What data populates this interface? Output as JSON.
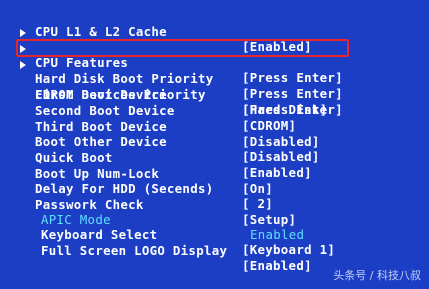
{
  "rows": [
    {
      "label": "CPU L1 & L2 Cache",
      "value": "[Enabled]",
      "arrow": false
    },
    {
      "label": "CPU Features",
      "value": "[Press Enter]",
      "arrow": true
    },
    {
      "label": "Hard Disk Boot Priority",
      "value": "[Press Enter]",
      "arrow": true
    },
    {
      "label": "CDROM Devices Priority",
      "value": "[Press Enter]",
      "arrow": true
    },
    {
      "label": "First Boot Device",
      "value": "[Hard Disk]",
      "arrow": false
    },
    {
      "label": "Second Boot Device",
      "value": "[CDROM]",
      "arrow": false
    },
    {
      "label": "Third Boot Device",
      "value": "[Disabled]",
      "arrow": false
    },
    {
      "label": "Boot Other Device",
      "value": "[Disabled]",
      "arrow": false
    },
    {
      "label": "Quick Boot",
      "value": "[Enabled]",
      "arrow": false
    },
    {
      "label": "Boot Up Num-Lock",
      "value": "[On]",
      "arrow": false
    },
    {
      "label": "Delay For HDD (Secends)",
      "value": "[ 2]",
      "arrow": false
    },
    {
      "label": "Passwork Check",
      "value": "[Setup]",
      "arrow": false
    },
    {
      "label": "APIC Mode",
      "value": "Enabled",
      "arrow": false
    },
    {
      "label": "Keyboard Select",
      "value": "[Keyboard 1]",
      "arrow": false
    },
    {
      "label": "Full Screen LOGO Display",
      "value": "[Enabled]",
      "arrow": false
    }
  ],
  "selected_row": 2,
  "highlight_color": "#e8262a",
  "background_color": "#1b3ec4",
  "watermark": "头条号 / 科技八叔"
}
